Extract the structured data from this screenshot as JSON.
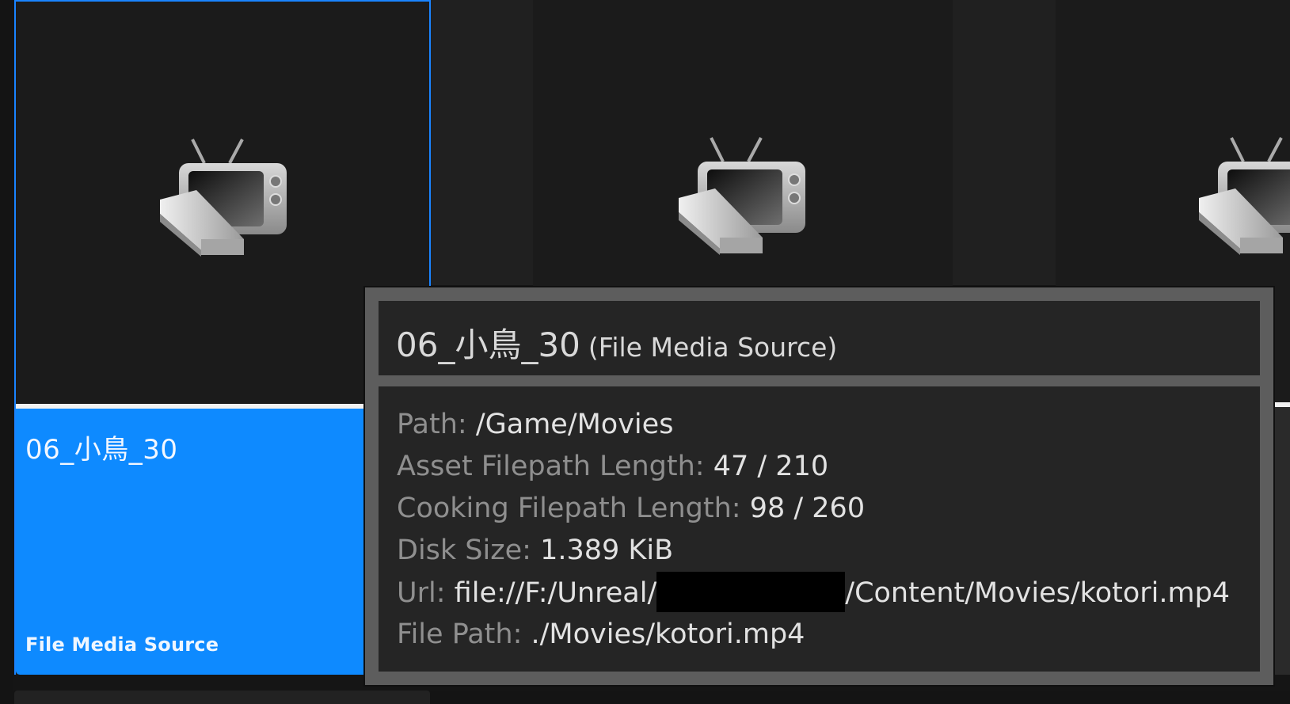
{
  "tiles": [
    {
      "name": "06_小鳥_30",
      "type": "File Media Source",
      "selected": true,
      "icon": "tv-icon"
    },
    {
      "icon": "tv-icon"
    },
    {
      "icon": "tv-icon"
    }
  ],
  "tooltip": {
    "title": "06_小鳥_30",
    "subtitle": "(File Media Source)",
    "rows": [
      {
        "key": "Path:",
        "value": "/Game/Movies"
      },
      {
        "key": "Asset Filepath Length:",
        "value": "47 / 210"
      },
      {
        "key": "Cooking Filepath Length:",
        "value": "98 / 260"
      },
      {
        "key": "Disk Size:",
        "value": "1.389 KiB"
      },
      {
        "key": "Url:",
        "value_before": "file://F:/Unreal/",
        "value_after": "/Content/Movies/kotori.mp4"
      },
      {
        "key": "File Path:",
        "value": "./Movies/kotori.mp4"
      }
    ]
  },
  "colors": {
    "selection": "#0e8aff",
    "tile_bg": "#1b1b1b",
    "tooltip_border": "#5d5d5d",
    "tooltip_bg": "#252525"
  }
}
